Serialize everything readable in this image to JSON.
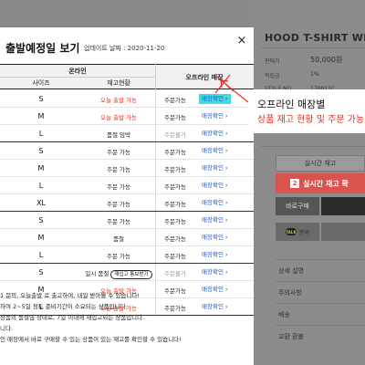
{
  "background_page": {
    "product_title": "HOOD T-SHIRT WH",
    "info_rows": [
      {
        "label": "판매가",
        "value": "50,000원"
      },
      {
        "label": "적립금",
        "value": "1%"
      },
      {
        "label": "STYLE NO",
        "value": "170011C"
      }
    ],
    "stock_button": "실시간 재고",
    "realtime_stock_button": {
      "number": "2",
      "label": "실시간 재고 확"
    },
    "buy_button": "바로구매",
    "talk_label": "문의",
    "talk_icon_text": "TALK",
    "sections": [
      "상세 설명",
      "주의사항",
      "배송",
      "교환 환불"
    ]
  },
  "modal": {
    "title": "출발예정일 보기",
    "updated": "업데이트 날짜 : 2020-11-20",
    "close_label": "×",
    "headers": {
      "online": "온라인",
      "offline": "오프라인 매장",
      "size": "사이즈",
      "stock": "재고현황"
    },
    "rows": [
      {
        "size": "S",
        "stock": "오늘 출발 가능",
        "stock_color": "red",
        "order": "주문가능",
        "order_gray": false,
        "store": "매장확인",
        "highlight": true
      },
      {
        "size": "M",
        "stock": "오늘 출발 가능",
        "stock_color": "red",
        "order": "주문가능",
        "order_gray": false,
        "store": "매장확인",
        "highlight": false
      },
      {
        "size": "L",
        "stock": "품절 임박",
        "stock_color": "default",
        "order": "주문불가",
        "order_gray": true,
        "store": "매장확인",
        "highlight": false,
        "group_end": true
      },
      {
        "size": "S",
        "stock": "주문 가능",
        "stock_color": "default",
        "order": "주문가능",
        "order_gray": false,
        "store": "매장확인",
        "highlight": false
      },
      {
        "size": "M",
        "stock": "주문 가능",
        "stock_color": "default",
        "order": "주문가능",
        "order_gray": false,
        "store": "매장확인",
        "highlight": false
      },
      {
        "size": "L",
        "stock": "주문 가능",
        "stock_color": "default",
        "order": "주문가능",
        "order_gray": false,
        "store": "매장확인",
        "highlight": false
      },
      {
        "size": "XL",
        "stock": "주문 가능",
        "stock_color": "default",
        "order": "주문가능",
        "order_gray": false,
        "store": "매장확인",
        "highlight": false,
        "group_end": true
      },
      {
        "size": "S",
        "stock": "주문 가능",
        "stock_color": "default",
        "order": "주문가능",
        "order_gray": false,
        "store": "매장확인",
        "highlight": false
      },
      {
        "size": "M",
        "stock": "품절",
        "stock_color": "default",
        "order": "주문가능",
        "order_gray": false,
        "store": "매장확인",
        "highlight": false
      },
      {
        "size": "L",
        "stock": "주문 가능",
        "stock_color": "default",
        "order": "주문가능",
        "order_gray": false,
        "store": "매장확인",
        "highlight": false,
        "group_end": true
      },
      {
        "size": "S",
        "stock": "일시 품절",
        "stock_color": "default",
        "restock": "재입고 통보받기",
        "order": "주문불가",
        "order_gray": true,
        "store": "매장확인",
        "highlight": false
      },
      {
        "size": "M",
        "stock": "오늘 출발 가능",
        "stock_color": "red",
        "order": "주문가능",
        "order_gray": false,
        "store": "매장확인",
        "highlight": false
      },
      {
        "size": "L",
        "stock": "오늘 출발 가능",
        "stock_color": "red",
        "order": "주문가능",
        "order_gray": false,
        "store": "매장확인",
        "highlight": false,
        "group_end": true
      }
    ],
    "store_arrow": "›",
    "notes": [
      "1 문의, 오늘출발 로 출고하여, 내일 받아볼 수 있습니다!",
      "하여 2~5일 정도 준비기간이 소요되는 상품입니다.",
      "상품의 품절임 상태로, 7일 이내에 재입고되는 상품입니다.",
      "니다.",
      "인 매장에서 바로 구매할 수 있는 상품이 있는 재고를 확인할 수 있습니다!"
    ]
  },
  "callout": {
    "line1": "오프라인 매장별",
    "line2": "상품 재고 현황 및 주문 가능"
  },
  "colors": {
    "highlight": "#43d9e3",
    "red": "#e0301e",
    "link_blue": "#1d56d1"
  }
}
